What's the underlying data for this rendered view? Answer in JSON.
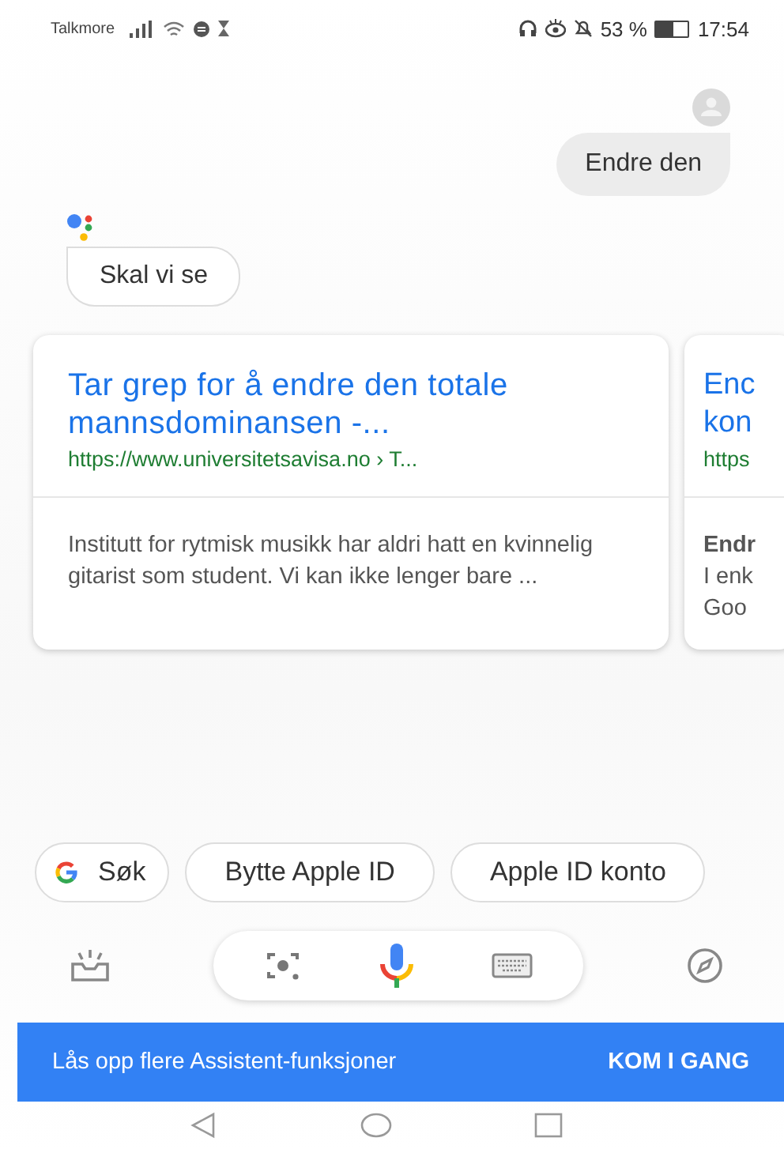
{
  "status_bar": {
    "carrier": "Talkmore",
    "battery_percent": "53 %",
    "time": "17:54"
  },
  "conversation": [
    {
      "kind": "user",
      "text": "Endre den"
    },
    {
      "kind": "assistant",
      "text": "Skal vi se"
    }
  ],
  "results": [
    {
      "title": "Tar grep for å endre den totale mannsdominansen -...",
      "url": "https://www.universitetsavisa.no › T...",
      "snippet": "Institutt for rytmisk musikk har aldri hatt en kvinnelig gitarist som student. Vi kan ikke lenger bare ..."
    },
    {
      "title_lines": [
        "Enc",
        "kon"
      ],
      "url": "https",
      "snippet_bold": "Endr",
      "snippet_lines": [
        "I enk",
        "Goo"
      ]
    }
  ],
  "suggestions": [
    {
      "kind": "google",
      "label": "Søk"
    },
    {
      "kind": "plain",
      "label": "Bytte Apple ID"
    },
    {
      "kind": "plain",
      "label": "Apple ID konto"
    }
  ],
  "banner": {
    "text": "Lås opp flere Assistent-funksjoner",
    "action": "KOM I GANG"
  }
}
